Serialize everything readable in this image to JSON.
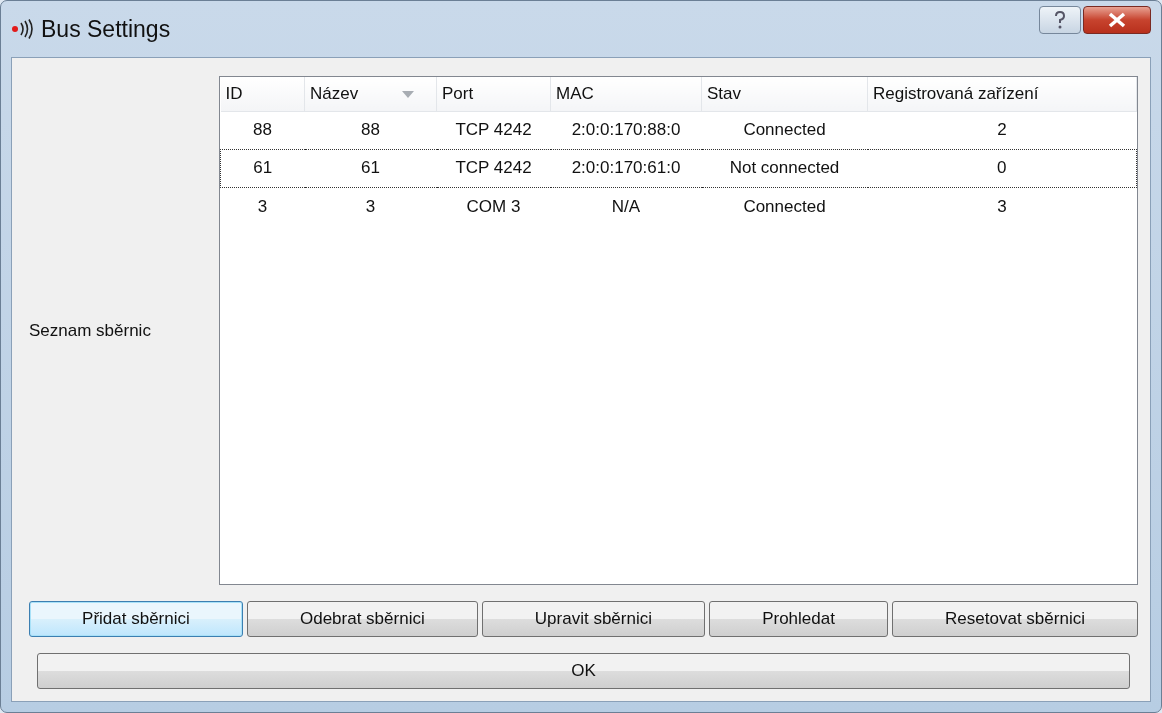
{
  "window": {
    "title": "Bus Settings"
  },
  "list_label": "Seznam sběrnic",
  "table": {
    "columns": [
      {
        "label": "ID",
        "sorted": false
      },
      {
        "label": "Název",
        "sorted": true
      },
      {
        "label": "Port",
        "sorted": false
      },
      {
        "label": "MAC",
        "sorted": false
      },
      {
        "label": "Stav",
        "sorted": false
      },
      {
        "label": "Registrovaná zařízení",
        "sorted": false
      }
    ],
    "rows": [
      {
        "cells": [
          "88",
          "88",
          "TCP 4242",
          "2:0:0:170:88:0",
          "Connected",
          "2"
        ],
        "focused": false
      },
      {
        "cells": [
          "61",
          "61",
          "TCP 4242",
          "2:0:0:170:61:0",
          "Not connected",
          "0"
        ],
        "focused": true
      },
      {
        "cells": [
          "3",
          "3",
          "COM 3",
          "N/A",
          "Connected",
          "3"
        ],
        "focused": false
      }
    ]
  },
  "buttons": [
    {
      "label": "Přidat sběrnici",
      "default": true
    },
    {
      "label": "Odebrat sběrnici",
      "default": false
    },
    {
      "label": "Upravit sběrnici",
      "default": false
    },
    {
      "label": "Prohledat",
      "default": false
    },
    {
      "label": "Resetovat sběrnici",
      "default": false
    }
  ],
  "ok_button": {
    "label": "OK"
  }
}
